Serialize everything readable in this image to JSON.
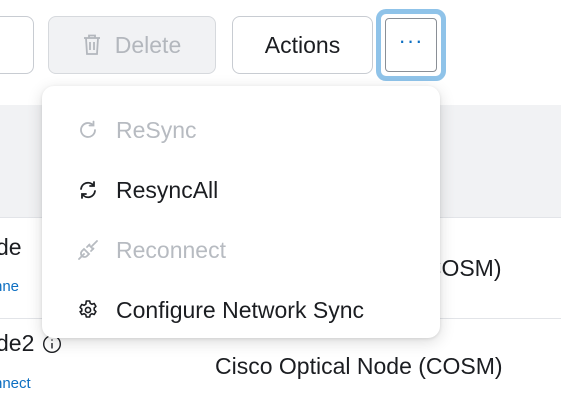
{
  "toolbar": {
    "delete_label": "Delete",
    "actions_label": "Actions",
    "more_label": "···"
  },
  "menu": {
    "items": [
      {
        "label": "ReSync",
        "icon": "resync-icon",
        "enabled": false
      },
      {
        "label": "ResyncAll",
        "icon": "resync-all-icon",
        "enabled": true
      },
      {
        "label": "Reconnect",
        "icon": "plug-icon",
        "enabled": false
      },
      {
        "label": "Configure Network Sync",
        "icon": "gear-icon",
        "enabled": true
      }
    ]
  },
  "table": {
    "rows": [
      {
        "name": "de",
        "link": "nne",
        "type": "e (COSM)"
      },
      {
        "name": "de2",
        "link": "nnect",
        "type": "Cisco Optical Node (COSM)"
      }
    ]
  },
  "colors": {
    "accent": "#0d6fc2",
    "focus_ring": "#8fc3e9",
    "disabled_text": "#b7bbc1",
    "header_band": "#f1f2f4"
  }
}
